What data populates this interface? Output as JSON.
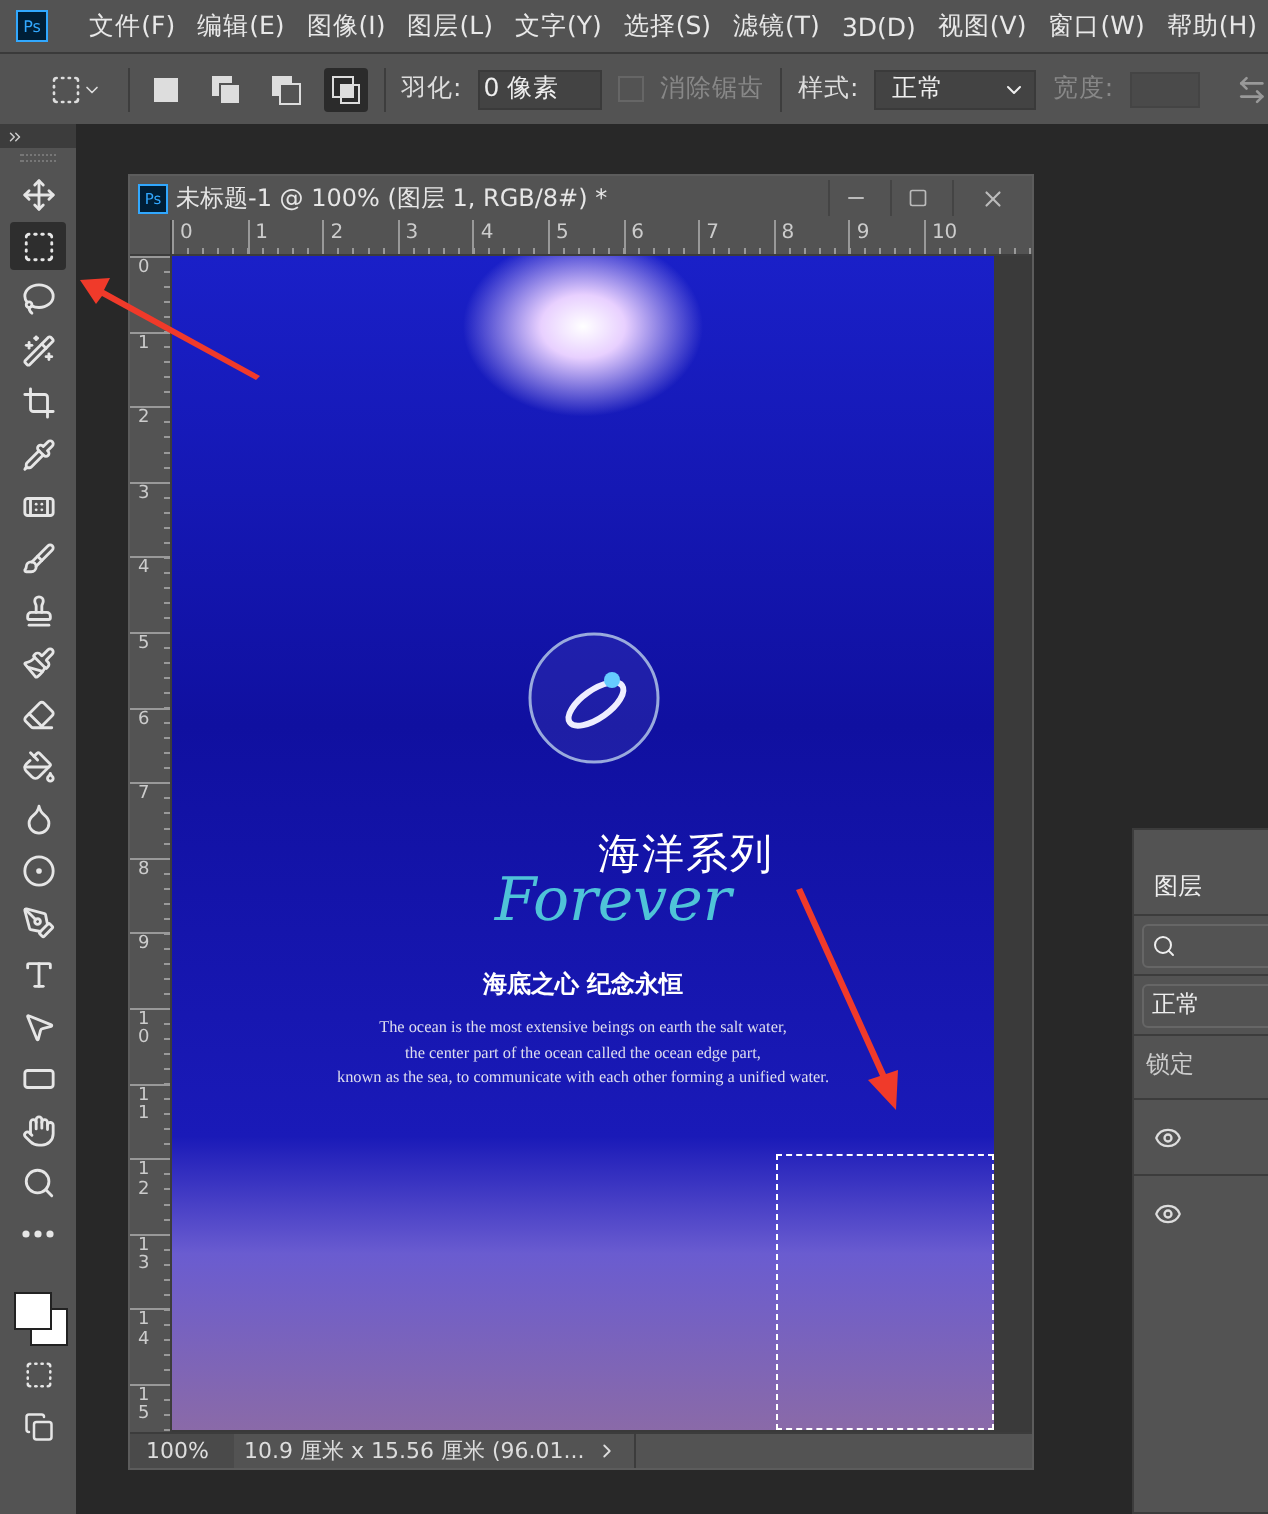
{
  "app_icon": "Ps",
  "menu": [
    "文件(F)",
    "编辑(E)",
    "图像(I)",
    "图层(L)",
    "文字(Y)",
    "选择(S)",
    "滤镜(T)",
    "3D(D)",
    "视图(V)",
    "窗口(W)",
    "帮助(H)"
  ],
  "options_bar": {
    "selection_modes": [
      {
        "kind": "new",
        "selected": false
      },
      {
        "kind": "add",
        "selected": false
      },
      {
        "kind": "subtract",
        "selected": false
      },
      {
        "kind": "intersect",
        "selected": true
      }
    ],
    "feather_label": "羽化:",
    "feather_value": "0 像素",
    "anti_alias": {
      "label": "消除锯齿",
      "checked": false,
      "disabled": true
    },
    "style_label": "样式:",
    "style_value": "正常",
    "width_label": "宽度:"
  },
  "tools": [
    {
      "kind": "move",
      "selected": false
    },
    {
      "kind": "marquee",
      "selected": true
    },
    {
      "kind": "lasso",
      "selected": false
    },
    {
      "kind": "wand",
      "selected": false
    },
    {
      "kind": "crop",
      "selected": false
    },
    {
      "kind": "eyedropper",
      "selected": false
    },
    {
      "kind": "healing",
      "selected": false
    },
    {
      "kind": "brush",
      "selected": false
    },
    {
      "kind": "stamp",
      "selected": false
    },
    {
      "kind": "history",
      "selected": false
    },
    {
      "kind": "eraser",
      "selected": false
    },
    {
      "kind": "bucket",
      "selected": false
    },
    {
      "kind": "blur",
      "selected": false
    },
    {
      "kind": "dodge",
      "selected": false
    },
    {
      "kind": "pen",
      "selected": false
    },
    {
      "kind": "type",
      "selected": false
    },
    {
      "kind": "select",
      "selected": false
    },
    {
      "kind": "shape",
      "selected": false
    },
    {
      "kind": "hand",
      "selected": false
    },
    {
      "kind": "zoom",
      "selected": false
    },
    {
      "kind": "more",
      "selected": false
    }
  ],
  "document": {
    "app_icon": "Ps",
    "title": "未标题-1 @ 100% (图层 1, RGB/8#) *",
    "ruler_h": [
      "0",
      "1",
      "2",
      "3",
      "4",
      "5",
      "6",
      "7",
      "8",
      "9",
      "10"
    ],
    "ruler_v": [
      "0",
      "1",
      "2",
      "3",
      "4",
      "5",
      "6",
      "7",
      "8",
      "9",
      "10",
      "11",
      "12",
      "13",
      "14",
      "15"
    ],
    "poster": {
      "title": "海洋系列",
      "script": "Forever",
      "slogan": "海底之心 纪念永恒",
      "lines": [
        "The ocean is the most extensive beings on earth the salt water,",
        "the center part of the ocean called the ocean edge part,",
        "known as the sea, to communicate with each other forming a unified water."
      ]
    },
    "status": {
      "zoom": "100%",
      "info": "10.9 厘米 x 15.56 厘米 (96.01..."
    }
  },
  "layers_panel": {
    "tab": "图层",
    "blend": "正常",
    "lock_label": "锁定",
    "layers": [
      {
        "visible": true
      },
      {
        "visible": true
      }
    ]
  }
}
